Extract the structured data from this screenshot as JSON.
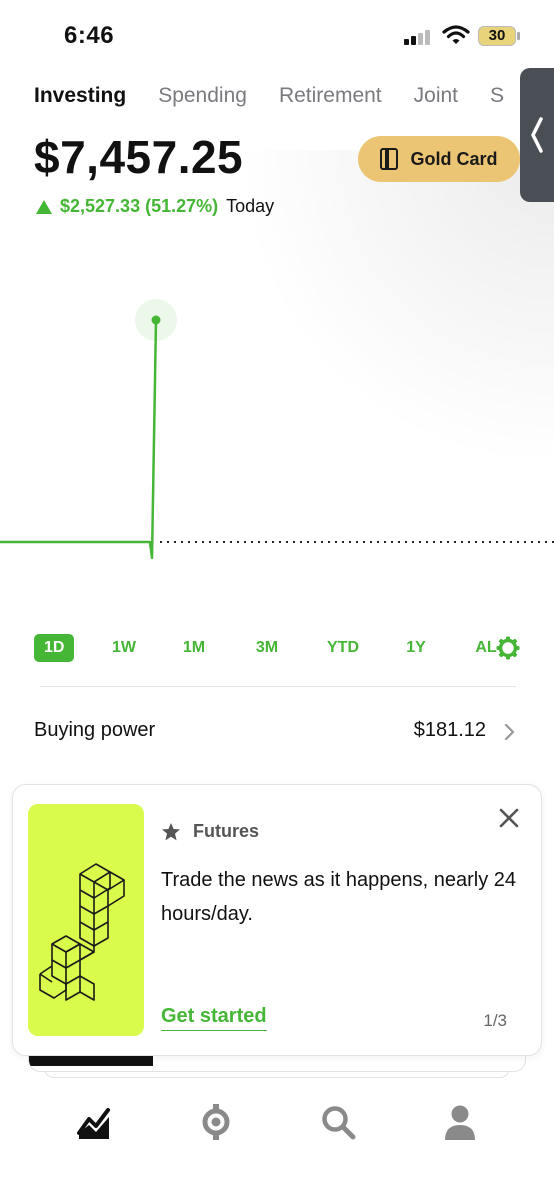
{
  "status_bar": {
    "time": "6:46",
    "battery": "30"
  },
  "account_tabs": [
    {
      "label": "Investing",
      "active": true
    },
    {
      "label": "Spending",
      "active": false
    },
    {
      "label": "Retirement",
      "active": false
    },
    {
      "label": "Joint",
      "active": false
    },
    {
      "label": "S",
      "active": false
    }
  ],
  "portfolio": {
    "value": "$7,457.25",
    "change": "$2,527.33 (51.27%)",
    "change_period": "Today",
    "change_direction": "up"
  },
  "gold_card_button": {
    "label": "Gold Card",
    "icon": "card-icon"
  },
  "chart_data": {
    "type": "line",
    "title": "",
    "xlabel": "",
    "ylabel": "",
    "x": [
      0,
      1,
      2,
      3
    ],
    "values": [
      4929.92,
      4929.92,
      4750,
      7457.25
    ],
    "baseline": 4929.92,
    "color": "#45b635",
    "grid": false
  },
  "range_tabs": [
    {
      "label": "1D",
      "active": true
    },
    {
      "label": "1W",
      "active": false
    },
    {
      "label": "1M",
      "active": false
    },
    {
      "label": "3M",
      "active": false
    },
    {
      "label": "YTD",
      "active": false
    },
    {
      "label": "1Y",
      "active": false
    },
    {
      "label": "AL",
      "active": false
    }
  ],
  "buying_power": {
    "label": "Buying power",
    "value": "$181.12"
  },
  "promo": {
    "tag": "Futures",
    "text": "Trade the news as it happens, nearly 24 hours/day.",
    "cta": "Get started",
    "pager": "1/3",
    "art_color": "#d8fb4c"
  },
  "bottom_nav": [
    {
      "icon": "investing-chart-icon",
      "active": true
    },
    {
      "icon": "crypto-icon",
      "active": false
    },
    {
      "icon": "search-icon",
      "active": false
    },
    {
      "icon": "account-icon",
      "active": false
    }
  ],
  "colors": {
    "accent": "#45b635",
    "gold": "#ebc574",
    "text": "#111111",
    "muted": "#7a7a7f"
  }
}
